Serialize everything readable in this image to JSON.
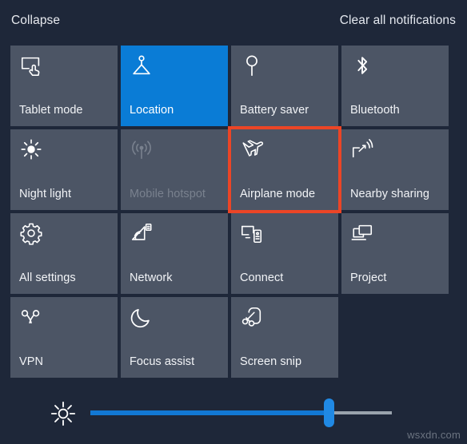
{
  "header": {
    "collapse_label": "Collapse",
    "clear_all_label": "Clear all notifications"
  },
  "colors": {
    "background": "#1e2739",
    "tile": "#4c5565",
    "tile_active": "#0a7cd6",
    "highlight_border": "#ec4526",
    "slider_fill": "#1278d4",
    "slider_track": "#9aa3ad",
    "text": "#f2f4f7",
    "text_disabled": "#79818e"
  },
  "quick_actions": {
    "tiles": [
      {
        "label": "Tablet mode",
        "icon": "tablet-mode-icon",
        "state": "off",
        "highlighted": false
      },
      {
        "label": "Location",
        "icon": "location-icon",
        "state": "on",
        "highlighted": false
      },
      {
        "label": "Battery saver",
        "icon": "battery-saver-icon",
        "state": "off",
        "highlighted": false
      },
      {
        "label": "Bluetooth",
        "icon": "bluetooth-icon",
        "state": "off",
        "highlighted": false
      },
      {
        "label": "Night light",
        "icon": "night-light-icon",
        "state": "off",
        "highlighted": false
      },
      {
        "label": "Mobile hotspot",
        "icon": "mobile-hotspot-icon",
        "state": "disabled",
        "highlighted": false
      },
      {
        "label": "Airplane mode",
        "icon": "airplane-mode-icon",
        "state": "off",
        "highlighted": true
      },
      {
        "label": "Nearby sharing",
        "icon": "nearby-sharing-icon",
        "state": "off",
        "highlighted": false
      },
      {
        "label": "All settings",
        "icon": "gear-icon",
        "state": "off",
        "highlighted": false
      },
      {
        "label": "Network",
        "icon": "network-icon",
        "state": "off",
        "highlighted": false
      },
      {
        "label": "Connect",
        "icon": "connect-icon",
        "state": "off",
        "highlighted": false
      },
      {
        "label": "Project",
        "icon": "project-icon",
        "state": "off",
        "highlighted": false
      },
      {
        "label": "VPN",
        "icon": "vpn-icon",
        "state": "off",
        "highlighted": false
      },
      {
        "label": "Focus assist",
        "icon": "moon-icon",
        "state": "off",
        "highlighted": false
      },
      {
        "label": "Screen snip",
        "icon": "screen-snip-icon",
        "state": "off",
        "highlighted": false
      },
      {
        "label": "",
        "icon": "",
        "state": "empty",
        "highlighted": false
      }
    ]
  },
  "brightness": {
    "icon": "brightness-sun-icon",
    "value_percent": 79,
    "min": 0,
    "max": 100
  },
  "watermark": {
    "text": "wsxdn.com"
  }
}
